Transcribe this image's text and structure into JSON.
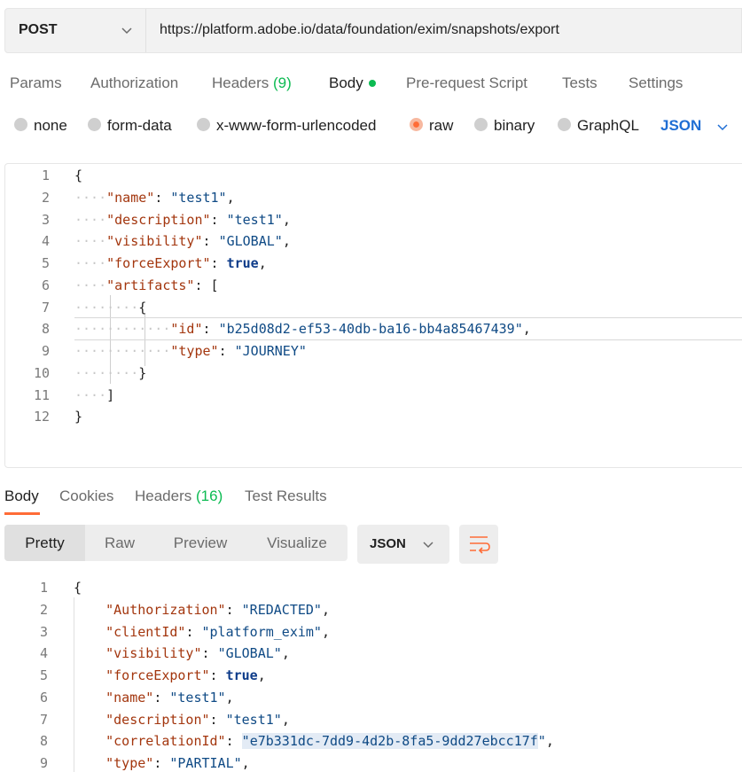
{
  "request": {
    "method": "POST",
    "url": "https://platform.adobe.io/data/foundation/exim/snapshots/export"
  },
  "request_tabs": {
    "params": "Params",
    "authorization": "Authorization",
    "headers": "Headers",
    "headers_count": "(9)",
    "body": "Body",
    "pre_request": "Pre-request Script",
    "tests": "Tests",
    "settings": "Settings"
  },
  "body_types": {
    "none": "none",
    "form_data": "form-data",
    "urlencoded": "x-www-form-urlencoded",
    "raw": "raw",
    "binary": "binary",
    "graphql": "GraphQL",
    "selected": "raw",
    "language": "JSON"
  },
  "request_body": {
    "line_numbers": [
      "1",
      "2",
      "3",
      "4",
      "5",
      "6",
      "7",
      "8",
      "9",
      "10",
      "11",
      "12"
    ],
    "name_key": "\"name\"",
    "name_val": "\"test1\"",
    "description_key": "\"description\"",
    "description_val": "\"test1\"",
    "visibility_key": "\"visibility\"",
    "visibility_val": "\"GLOBAL\"",
    "forceExport_key": "\"forceExport\"",
    "forceExport_val": "true",
    "artifacts_key": "\"artifacts\"",
    "id_key": "\"id\"",
    "id_val": "\"b25d08d2-ef53-40db-ba16-bb4a85467439\"",
    "type_key": "\"type\"",
    "type_val": "\"JOURNEY\""
  },
  "response_tabs": {
    "body": "Body",
    "cookies": "Cookies",
    "headers": "Headers",
    "headers_count": "(16)",
    "test_results": "Test Results"
  },
  "view_modes": {
    "pretty": "Pretty",
    "raw": "Raw",
    "preview": "Preview",
    "visualize": "Visualize",
    "format": "JSON"
  },
  "response_body": {
    "line_numbers": [
      "1",
      "2",
      "3",
      "4",
      "5",
      "6",
      "7",
      "8",
      "9"
    ],
    "authorization_key": "\"Authorization\"",
    "authorization_val": "\"REDACTED\"",
    "clientId_key": "\"clientId\"",
    "clientId_val": "\"platform_exim\"",
    "visibility_key": "\"visibility\"",
    "visibility_val": "\"GLOBAL\"",
    "forceExport_key": "\"forceExport\"",
    "forceExport_val": "true",
    "name_key": "\"name\"",
    "name_val": "\"test1\"",
    "description_key": "\"description\"",
    "description_val": "\"test1\"",
    "correlationId_key": "\"correlationId\"",
    "correlationId_quote": "\"",
    "correlationId_val": "e7b331dc-7dd9-4d2b-8fa5-9dd27ebcc17f",
    "type_key": "\"type\"",
    "type_val": "\"PARTIAL\""
  },
  "colors": {
    "accent": "#ff6c37",
    "count_green": "#0cbb52",
    "link_blue": "#1f6ed4"
  },
  "icons": {
    "method_dropdown": "chevron-down-icon",
    "language_dropdown": "chevron-down-icon",
    "format_dropdown": "chevron-down-icon",
    "wrap": "wrap-lines-icon"
  }
}
